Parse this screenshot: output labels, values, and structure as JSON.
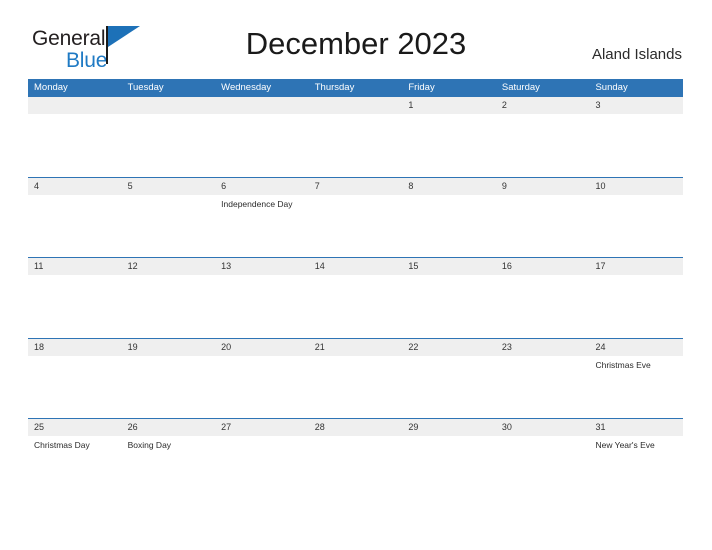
{
  "brand": {
    "name_part1": "General",
    "name_part2": "Blue",
    "flag_icon": "blue-flag-icon"
  },
  "header": {
    "title": "December 2023",
    "region": "Aland Islands"
  },
  "colors": {
    "header_blue": "#2e74b5",
    "band_gray": "#efefef",
    "logo_blue": "#1f7ac4",
    "text_dark": "#1a1a1a"
  },
  "calendar": {
    "weekdays": [
      "Monday",
      "Tuesday",
      "Wednesday",
      "Thursday",
      "Friday",
      "Saturday",
      "Sunday"
    ],
    "weeks": [
      {
        "days": [
          {
            "num": "",
            "event": ""
          },
          {
            "num": "",
            "event": ""
          },
          {
            "num": "",
            "event": ""
          },
          {
            "num": "",
            "event": ""
          },
          {
            "num": "1",
            "event": ""
          },
          {
            "num": "2",
            "event": ""
          },
          {
            "num": "3",
            "event": ""
          }
        ]
      },
      {
        "days": [
          {
            "num": "4",
            "event": ""
          },
          {
            "num": "5",
            "event": ""
          },
          {
            "num": "6",
            "event": "Independence Day"
          },
          {
            "num": "7",
            "event": ""
          },
          {
            "num": "8",
            "event": ""
          },
          {
            "num": "9",
            "event": ""
          },
          {
            "num": "10",
            "event": ""
          }
        ]
      },
      {
        "days": [
          {
            "num": "11",
            "event": ""
          },
          {
            "num": "12",
            "event": ""
          },
          {
            "num": "13",
            "event": ""
          },
          {
            "num": "14",
            "event": ""
          },
          {
            "num": "15",
            "event": ""
          },
          {
            "num": "16",
            "event": ""
          },
          {
            "num": "17",
            "event": ""
          }
        ]
      },
      {
        "days": [
          {
            "num": "18",
            "event": ""
          },
          {
            "num": "19",
            "event": ""
          },
          {
            "num": "20",
            "event": ""
          },
          {
            "num": "21",
            "event": ""
          },
          {
            "num": "22",
            "event": ""
          },
          {
            "num": "23",
            "event": ""
          },
          {
            "num": "24",
            "event": "Christmas Eve"
          }
        ]
      },
      {
        "days": [
          {
            "num": "25",
            "event": "Christmas Day"
          },
          {
            "num": "26",
            "event": "Boxing Day"
          },
          {
            "num": "27",
            "event": ""
          },
          {
            "num": "28",
            "event": ""
          },
          {
            "num": "29",
            "event": ""
          },
          {
            "num": "30",
            "event": ""
          },
          {
            "num": "31",
            "event": "New Year's Eve"
          }
        ]
      }
    ]
  }
}
